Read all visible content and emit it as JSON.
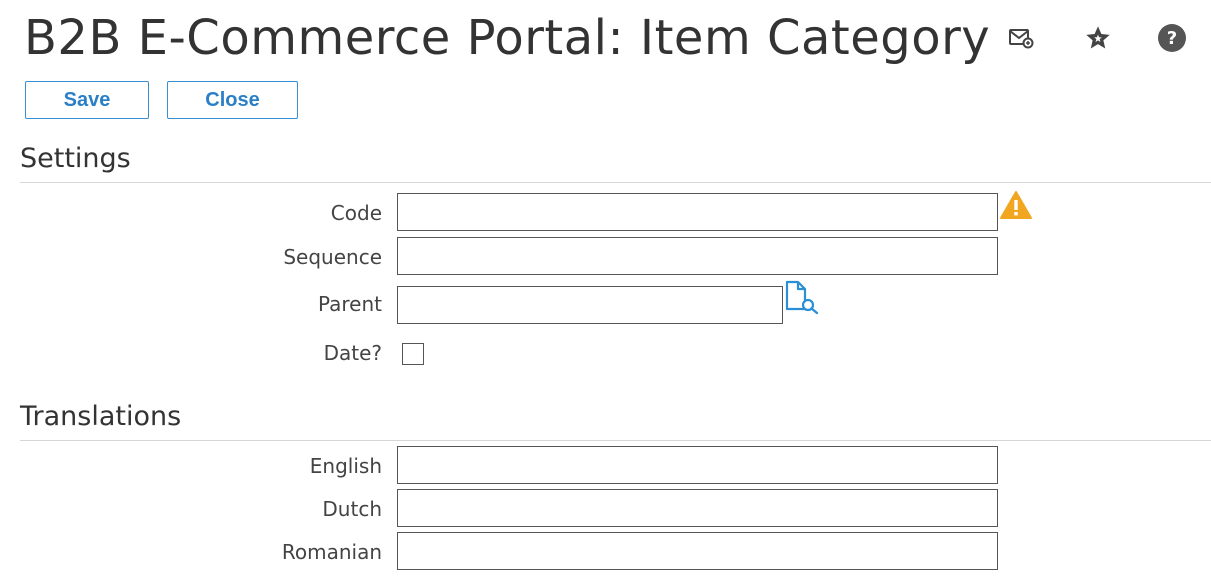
{
  "header": {
    "title": "B2B E-Commerce Portal: Item Category",
    "icons": [
      "mail-icon",
      "star-icon",
      "help-icon"
    ]
  },
  "toolbar": {
    "save_label": "Save",
    "close_label": "Close"
  },
  "settings": {
    "title": "Settings",
    "code": {
      "label": "Code",
      "value": ""
    },
    "sequence": {
      "label": "Sequence",
      "value": ""
    },
    "parent": {
      "label": "Parent",
      "value": ""
    },
    "date": {
      "label": "Date?",
      "checked": false
    }
  },
  "translations": {
    "title": "Translations",
    "english": {
      "label": "English",
      "value": ""
    },
    "dutch": {
      "label": "Dutch",
      "value": ""
    },
    "romanian": {
      "label": "Romanian",
      "value": ""
    }
  },
  "colors": {
    "accent": "#2a7fc7",
    "warning": "#f2a51f",
    "text": "#333333"
  }
}
